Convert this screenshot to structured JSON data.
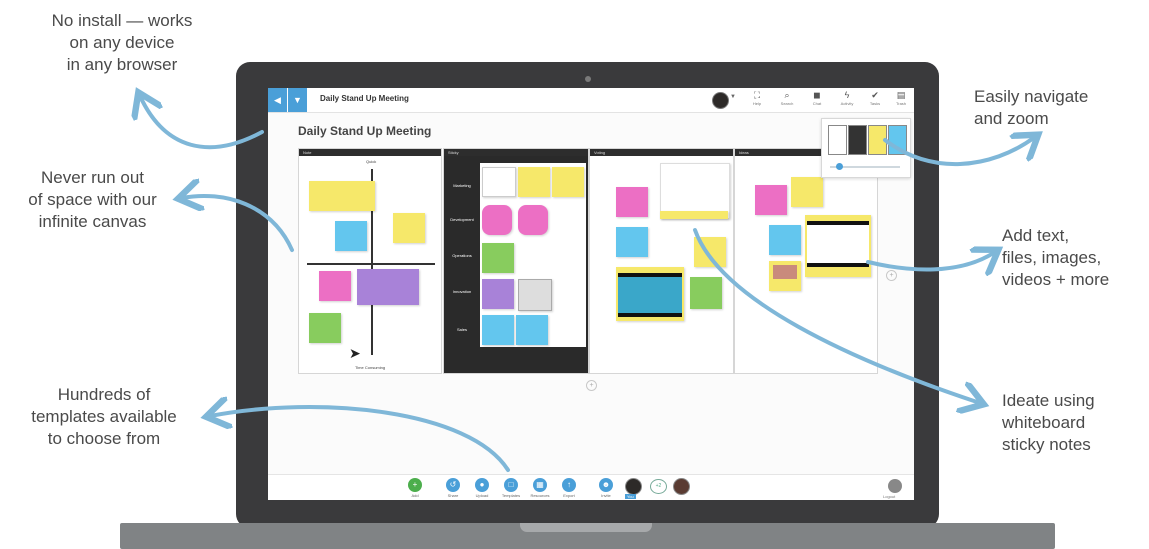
{
  "callouts": {
    "install": [
      "No install — works",
      "on any device",
      "in any browser"
    ],
    "canvas": [
      "Never run out",
      "of space with our",
      "infinite canvas"
    ],
    "templates": [
      "Hundreds of",
      "templates available",
      "to choose from"
    ],
    "navigate": [
      "Easily navigate",
      "and zoom"
    ],
    "add": [
      "Add text,",
      "files, images,",
      "videos + more"
    ],
    "ideate": [
      "Ideate using",
      "whiteboard",
      "sticky notes"
    ]
  },
  "app": {
    "board_name": "Daily Stand Up Meeting",
    "canvas_title": "Daily Stand Up Meeting",
    "toolbar": [
      {
        "icon": "fit-screen-icon",
        "glyph": "⛶",
        "label": "Help"
      },
      {
        "icon": "search-icon",
        "glyph": "⌕",
        "label": "Search"
      },
      {
        "icon": "chat-icon",
        "glyph": "◼",
        "label": "Chat"
      },
      {
        "icon": "activity-icon",
        "glyph": "ϟ",
        "label": "Activity"
      },
      {
        "icon": "check-icon",
        "glyph": "✔",
        "label": "Tasks"
      },
      {
        "icon": "trash-icon",
        "glyph": "▤",
        "label": "Trash"
      }
    ],
    "frames": [
      {
        "title": "Note"
      },
      {
        "title": "Sticky"
      },
      {
        "title": "Voting"
      },
      {
        "title": "Ideas"
      }
    ],
    "quadrant": {
      "top_label": "Quick",
      "bottom_label": "Time Consuming"
    },
    "swimlanes": [
      "Marketing",
      "Development",
      "Operations",
      "Innovation",
      "Sales"
    ],
    "bottom_bar": [
      {
        "icon": "add-icon",
        "label": "Add",
        "color": "#4cae4c"
      },
      {
        "icon": "share-icon",
        "label": "Share",
        "color": "#4a9fd8"
      },
      {
        "icon": "upload-icon",
        "label": "Upload",
        "color": "#4a9fd8"
      },
      {
        "icon": "templates-icon",
        "label": "Templates",
        "color": "#4a9fd8"
      },
      {
        "icon": "resources-icon",
        "label": "Resources",
        "color": "#4a9fd8"
      },
      {
        "icon": "export-icon",
        "label": "Export",
        "color": "#4a9fd8"
      },
      {
        "icon": "invite-icon",
        "label": "Invite",
        "color": "#4a9fd8"
      }
    ],
    "user_tag": "You",
    "page_badge": "+2",
    "logout_label": "Logout"
  },
  "colors": {
    "accent": "#4a9fd8",
    "arrow": "#7fb7d8",
    "sticky_yellow": "#f6e86a",
    "sticky_pink": "#ec6fc4",
    "sticky_blue": "#63c6ee",
    "sticky_green": "#88cc5e",
    "sticky_purple": "#a882d8",
    "sticky_orange": "#f6b84f"
  }
}
